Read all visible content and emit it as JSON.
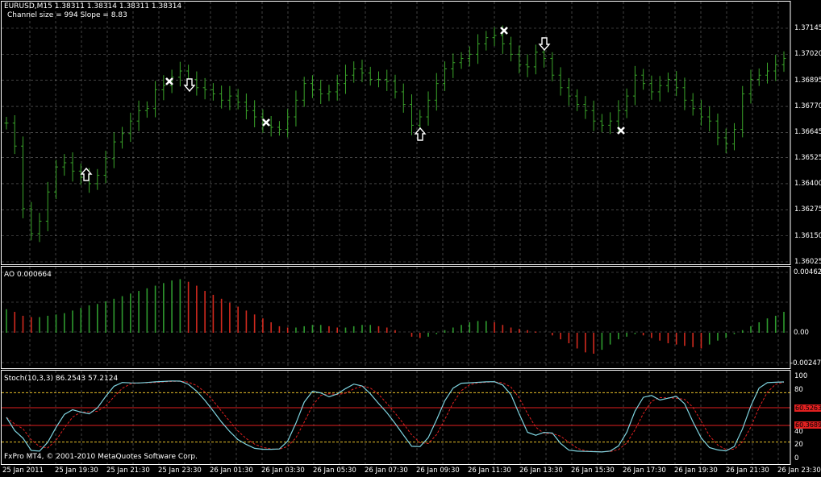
{
  "main": {
    "symbol_line": "EURUSD,M15  1.38311 1.38314 1.38311 1.38314",
    "info_line": "Channel size = 994 Slope = 8.83",
    "price_scale": [
      "1.37145",
      "1.37020",
      "1.36895",
      "1.36770",
      "1.36645",
      "1.36525",
      "1.36400",
      "1.36275",
      "1.36150",
      "1.36025"
    ]
  },
  "ao": {
    "label": "AO 0.000664",
    "scale": [
      "0.00462",
      "0.00",
      "-0.00247"
    ]
  },
  "stoch": {
    "label": "Stoch(10,3,3) 86.2543 57.2124",
    "scale": [
      "100",
      "80",
      "40",
      "20",
      "0"
    ],
    "level_boxes": [
      "60.5263",
      "60.3689"
    ],
    "copyright": "FxPro MT4, © 2001-2010 MetaQuotes Software Corp."
  },
  "time_axis": [
    "25 Jan 2011",
    "25 Jan 19:30",
    "25 Jan 21:30",
    "25 Jan 23:30",
    "26 Jan 01:30",
    "26 Jan 03:30",
    "26 Jan 05:30",
    "26 Jan 07:30",
    "26 Jan 09:30",
    "26 Jan 11:30",
    "26 Jan 13:30",
    "26 Jan 15:30",
    "26 Jan 17:30",
    "26 Jan 19:30",
    "26 Jan 21:30",
    "26 Jan 23:30"
  ],
  "colors": {
    "background": "#000000",
    "grid": "#c8c8c8",
    "bar": "#3aa52a",
    "ao_up": "#2e9a2e",
    "ao_down": "#d22a1e",
    "stoch_main": "#7fd4e0",
    "stoch_signal": "#e02020",
    "level_dotted": "#e6c02a",
    "level_red": "#e02020"
  },
  "chart_data": {
    "type": "line",
    "series": [
      {
        "name": "EURUSD,M15",
        "values": [
          1.3669,
          1.3658,
          1.3628,
          1.3616,
          1.3622,
          1.3636,
          1.3648,
          1.365,
          1.3646,
          1.3643,
          1.364,
          1.3644,
          1.3652,
          1.366,
          1.3664,
          1.367,
          1.3675,
          1.3676,
          1.3685,
          1.3687,
          1.3691,
          1.3694,
          1.369,
          1.3686,
          1.3685,
          1.3683,
          1.368,
          1.3682,
          1.3679,
          1.3675,
          1.3672,
          1.3668,
          1.3667,
          1.3666,
          1.3672,
          1.368,
          1.3688,
          1.3685,
          1.3683,
          1.3684,
          1.3688,
          1.3692,
          1.3695,
          1.3693,
          1.369,
          1.369,
          1.3689,
          1.3684,
          1.3678,
          1.3668,
          1.3672,
          1.368,
          1.3688,
          1.3695,
          1.3698,
          1.37,
          1.3702,
          1.3707,
          1.371,
          1.3711,
          1.3707,
          1.3702,
          1.3697,
          1.3696,
          1.3703,
          1.37,
          1.3692,
          1.3686,
          1.3682,
          1.3678,
          1.3675,
          1.367,
          1.3668,
          1.367,
          1.3675,
          1.3682,
          1.3692,
          1.3688,
          1.3684,
          1.3687,
          1.369,
          1.3686,
          1.368,
          1.3676,
          1.3672,
          1.367,
          1.3662,
          1.3659,
          1.3666,
          1.3683,
          1.369,
          1.3692,
          1.3694,
          1.3697,
          1.37
        ]
      },
      {
        "name": "AO",
        "values": [
          0.0018,
          0.0016,
          0.0013,
          0.0012,
          0.0012,
          0.0013,
          0.0014,
          0.0015,
          0.0017,
          0.0019,
          0.0021,
          0.0022,
          0.0024,
          0.0026,
          0.0028,
          0.003,
          0.0032,
          0.0034,
          0.0036,
          0.0038,
          0.004,
          0.0041,
          0.0039,
          0.0036,
          0.0032,
          0.0029,
          0.0026,
          0.0023,
          0.002,
          0.0017,
          0.0014,
          0.0011,
          0.0008,
          0.0005,
          0.0004,
          0.0004,
          0.0005,
          0.0006,
          0.0006,
          0.0005,
          0.0004,
          0.0004,
          0.0005,
          0.0006,
          0.0006,
          0.0005,
          0.0004,
          0.0002,
          0.0,
          -0.0003,
          -0.0004,
          -0.0003,
          -0.0001,
          0.0002,
          0.0004,
          0.0006,
          0.0008,
          0.0009,
          0.0009,
          0.0008,
          0.0006,
          0.0004,
          0.0003,
          0.0002,
          0.0001,
          0.0,
          -0.0002,
          -0.0005,
          -0.0008,
          -0.0012,
          -0.0015,
          -0.0016,
          -0.0013,
          -0.0009,
          -0.0005,
          -0.0003,
          -0.0001,
          -0.0002,
          -0.0004,
          -0.0006,
          -0.0008,
          -0.0009,
          -0.001,
          -0.0011,
          -0.0012,
          -0.0009,
          -0.0006,
          -0.0004,
          -0.0001,
          0.0002,
          0.0005,
          0.0008,
          0.0011,
          0.0013,
          0.0016
        ]
      }
    ]
  }
}
